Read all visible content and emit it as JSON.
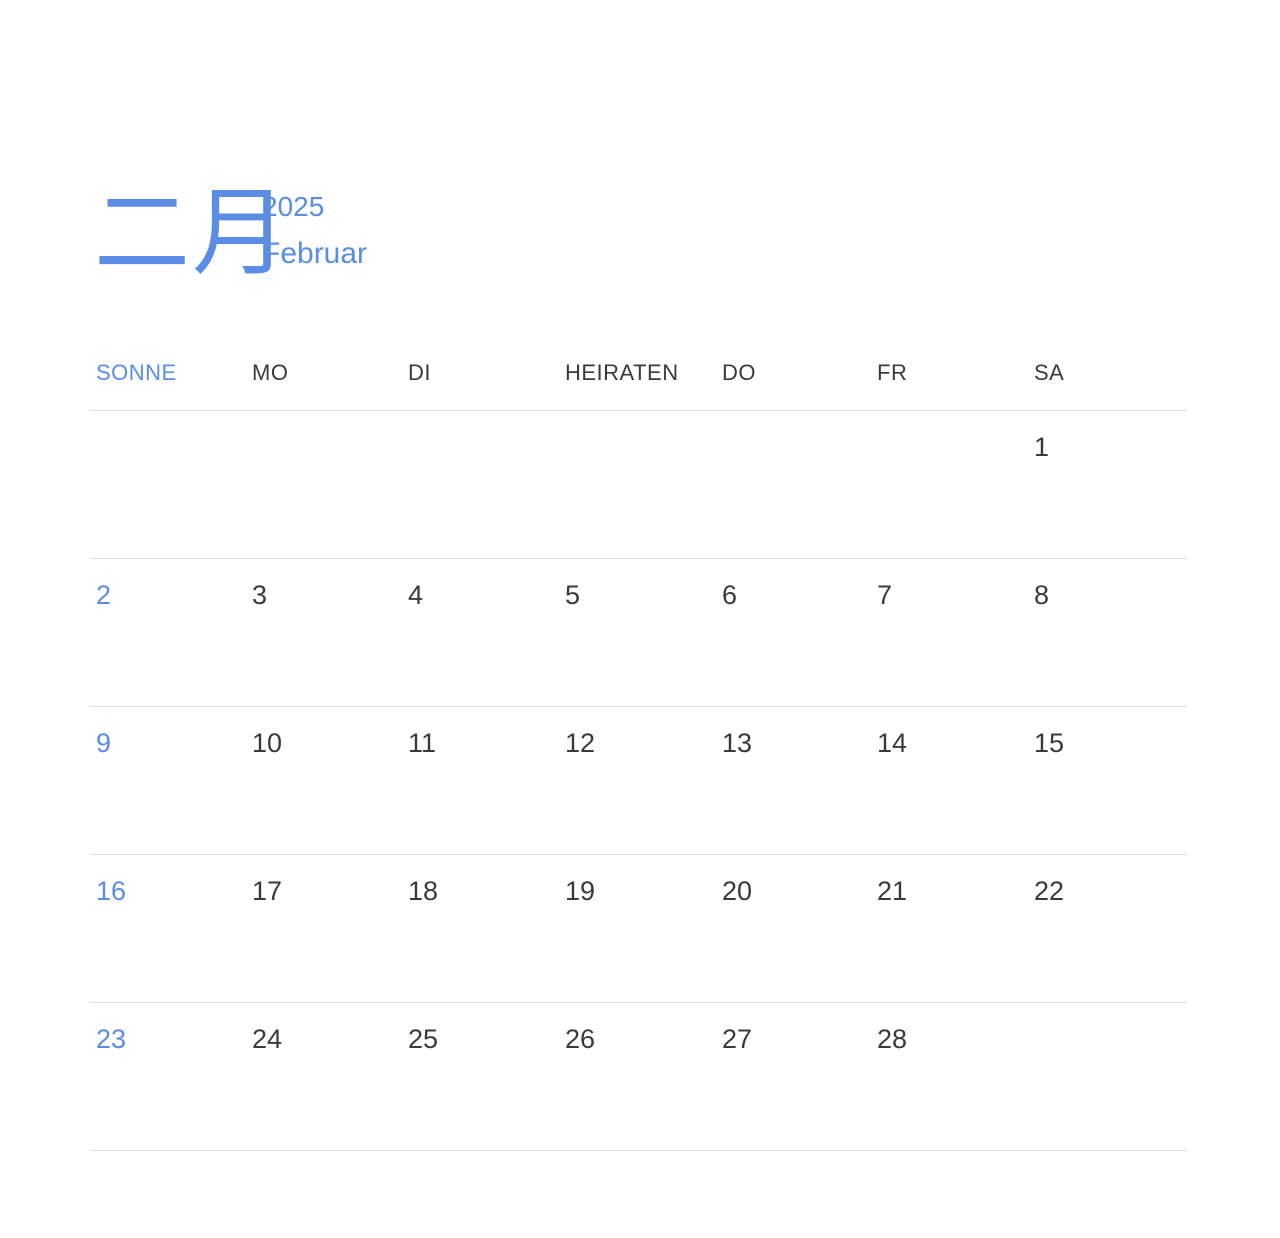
{
  "header": {
    "month_cjk": "二月",
    "year": "2025",
    "month_name": "Februar"
  },
  "colors": {
    "accent": "#5a8de3",
    "text": "#3a3a3a",
    "divider": "#dedede"
  },
  "weekdays": [
    "SONNE",
    "MO",
    "DI",
    "HEIRATEN",
    "DO",
    "FR",
    "SA"
  ],
  "weeks": [
    [
      "",
      "",
      "",
      "",
      "",
      "",
      "1"
    ],
    [
      "2",
      "3",
      "4",
      "5",
      "6",
      "7",
      "8"
    ],
    [
      "9",
      "10",
      "11",
      "12",
      "13",
      "14",
      "15"
    ],
    [
      "16",
      "17",
      "18",
      "19",
      "20",
      "21",
      "22"
    ],
    [
      "23",
      "24",
      "25",
      "26",
      "27",
      "28",
      ""
    ]
  ]
}
